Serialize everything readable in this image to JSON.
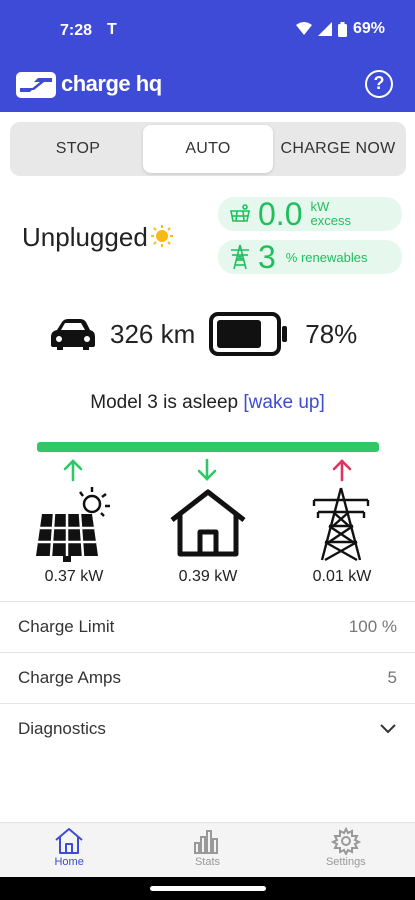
{
  "status_bar": {
    "time": "7:28",
    "notif_mark": "T",
    "battery_pct": "69%"
  },
  "app": {
    "brand": "charge hq",
    "help_label": "?"
  },
  "mode_tabs": [
    {
      "label": "STOP",
      "active": false
    },
    {
      "label": "AUTO",
      "active": true
    },
    {
      "label": "CHARGE NOW",
      "active": false
    }
  ],
  "charger": {
    "status": "Unplugged"
  },
  "excess": {
    "value": "0.0",
    "unit_top": "kW",
    "unit_bottom": "excess"
  },
  "renewables": {
    "value": "3",
    "unit": "% renewables"
  },
  "vehicle": {
    "range": "326 km",
    "battery": "78%",
    "battery_level": 0.78,
    "sleep_text": "Model 3 is asleep",
    "wake_label": "[wake up]"
  },
  "energy_flow": {
    "colors": {
      "bar": "#2ec866",
      "up": "#2ec866",
      "down": "#2ec866",
      "grid_up": "#e0345f"
    },
    "solar": {
      "kw": "0.37 kW",
      "direction": "up"
    },
    "home": {
      "kw": "0.39 kW",
      "direction": "down"
    },
    "grid": {
      "kw": "0.01 kW",
      "direction": "up"
    }
  },
  "settings": {
    "charge_limit": {
      "label": "Charge Limit",
      "value": "100 %"
    },
    "charge_amps": {
      "label": "Charge Amps",
      "value": "5"
    },
    "diagnostics": {
      "label": "Diagnostics"
    }
  },
  "nav": [
    {
      "label": "Home",
      "icon": "home-icon",
      "active": true
    },
    {
      "label": "Stats",
      "icon": "stats-icon",
      "active": false
    },
    {
      "label": "Settings",
      "icon": "gear-icon",
      "active": false
    }
  ],
  "theme": {
    "primary": "#3d4bd6",
    "green": "#1fbf5d",
    "pill_bg": "#e6f8ee"
  }
}
